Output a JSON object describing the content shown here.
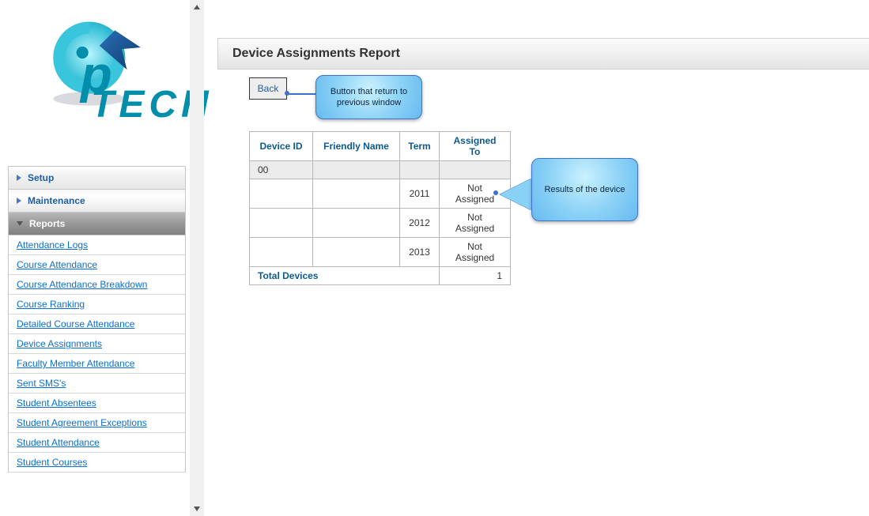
{
  "logo": {
    "text": "TECH"
  },
  "sidebar": {
    "sections": [
      {
        "label": "Setup"
      },
      {
        "label": "Maintenance"
      },
      {
        "label": "Reports"
      }
    ],
    "report_items": [
      "Attendance Logs",
      "Course Attendance",
      "Course Attendance Breakdown",
      "Course Ranking",
      "Detailed Course Attendance",
      "Device Assignments",
      "Faculty Member Attendance",
      "Sent SMS's",
      "Student Absentees",
      "Student Agreement Exceptions",
      "Student Attendance",
      "Student Courses"
    ]
  },
  "page": {
    "title": "Device Assignments Report",
    "back_label": "Back"
  },
  "callouts": {
    "back": "Button that return to previous window",
    "results": "Results of the device"
  },
  "table": {
    "headers": {
      "device_id": "Device ID",
      "friendly": "Friendly Name",
      "term": "Term",
      "assigned": "Assigned To"
    },
    "rows": [
      {
        "device_id": "00",
        "friendly": "",
        "term": "",
        "assigned": "",
        "shade": true
      },
      {
        "device_id": "",
        "friendly": "",
        "term": "2011",
        "assigned": "Not Assigned",
        "shade": false
      },
      {
        "device_id": "",
        "friendly": "",
        "term": "2012",
        "assigned": "Not Assigned",
        "shade": false
      },
      {
        "device_id": "",
        "friendly": "",
        "term": "2013",
        "assigned": "Not Assigned",
        "shade": false
      }
    ],
    "total_label": "Total Devices",
    "total_value": "1"
  }
}
